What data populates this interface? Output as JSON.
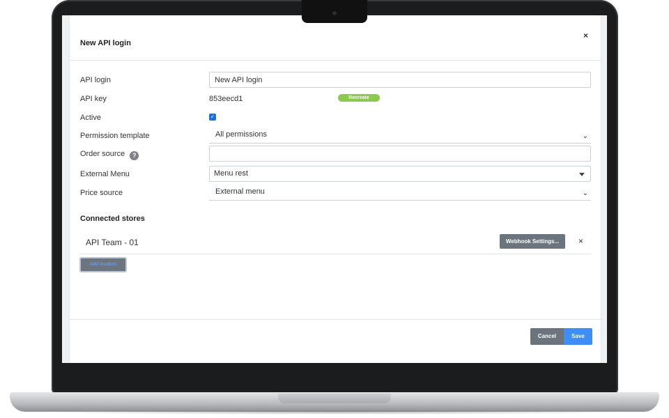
{
  "modal": {
    "title": "New API login",
    "close_icon": "close-icon",
    "close_glyph": "×"
  },
  "form": {
    "api_login": {
      "label": "API login",
      "value": "New API login"
    },
    "api_key": {
      "label": "API key",
      "value": "853eecd1",
      "recreate_label": "Recreate"
    },
    "active": {
      "label": "Active",
      "checked": true
    },
    "permission_template": {
      "label": "Permission template",
      "value": "All permissions"
    },
    "order_source": {
      "label": "Order source",
      "value": "",
      "help_icon": "help-icon"
    },
    "external_menu": {
      "label": "External Menu",
      "value": "Menu rest"
    },
    "price_source": {
      "label": "Price source",
      "value": "External menu"
    }
  },
  "connected_stores": {
    "title": "Connected stores",
    "stores": [
      {
        "name": "API Team - 01",
        "webhook_label": "Webhook Settings..."
      }
    ],
    "add_location_label": "Add location"
  },
  "footer": {
    "cancel_label": "Cancel",
    "save_label": "Save"
  },
  "colors": {
    "recreate": "#8cc94f",
    "checkbox": "#1d6fe0",
    "secondary_button": "#6c757d",
    "primary_button": "#3d8ef7"
  }
}
